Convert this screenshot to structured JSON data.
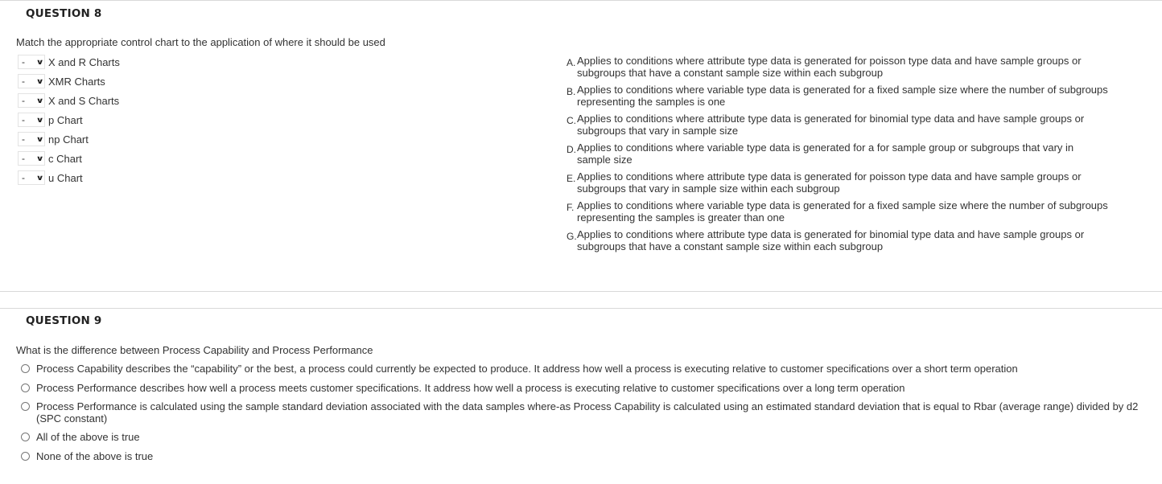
{
  "q8": {
    "header": "QUESTION 8",
    "prompt": "Match the appropriate control chart to the application of where it should be used",
    "items": [
      {
        "selected": "-",
        "label": "X and R Charts"
      },
      {
        "selected": "-",
        "label": "XMR Charts"
      },
      {
        "selected": "-",
        "label": "X and S Charts"
      },
      {
        "selected": "-",
        "label": "p Chart"
      },
      {
        "selected": "-",
        "label": "np Chart"
      },
      {
        "selected": "-",
        "label": "c Chart"
      },
      {
        "selected": "-",
        "label": "u Chart"
      }
    ],
    "answers": [
      {
        "letter": "A.",
        "text": "Applies to conditions where attribute type data is generated for poisson type data and have sample groups or subgroups that have a constant sample size within each subgroup"
      },
      {
        "letter": "B.",
        "text": "Applies to conditions where variable type data is generated for a fixed sample size where the number of subgroups representing the samples is one"
      },
      {
        "letter": "C.",
        "text": "Applies to conditions where attribute type data is generated for binomial type data and have sample groups or subgroups that vary in sample size"
      },
      {
        "letter": "D.",
        "text": "Applies to conditions where variable type data is generated for a for sample group or subgroups that vary in sample size"
      },
      {
        "letter": "E.",
        "text": "Applies to conditions where attribute type data is generated for poisson type data and have sample groups or subgroups that vary in sample size within each subgroup"
      },
      {
        "letter": "F.",
        "text": "Applies to conditions where variable type data is generated for a fixed sample size where the number of subgroups representing the samples is greater than one"
      },
      {
        "letter": "G.",
        "text": "Applies to conditions where attribute type data is generated for binomial type data and have sample groups or subgroups that have a constant sample size within each subgroup"
      }
    ]
  },
  "q9": {
    "header": "QUESTION 9",
    "prompt": "What is the difference between Process Capability and Process Performance",
    "options": [
      "Process Capability describes the “capability” or the best, a process could currently be expected to produce. It address how well a process is executing relative to customer specifications over a short term operation",
      "Process Performance describes how well a process meets customer specifications. It address how well a process is executing relative to customer specifications over a long term operation",
      "Process Performance is calculated using the sample standard deviation associated with the data samples where-as Process Capability is calculated using an estimated standard deviation that is equal to Rbar (average range) divided by d2 (SPC constant)",
      "All of the above is true",
      "None of the above is true"
    ]
  },
  "icons": {
    "dropdown": "chevron-down-icon",
    "radio": "radio-circle-icon"
  },
  "colors": {
    "text": "#333333",
    "divider": "#d9d9d9",
    "radio_border": "#777777"
  }
}
